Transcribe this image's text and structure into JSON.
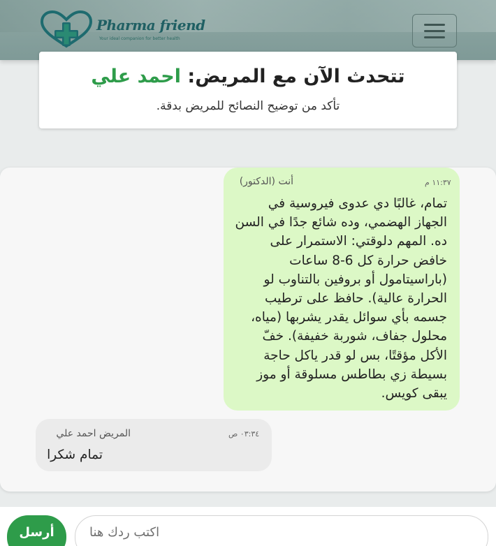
{
  "brand": {
    "name": "Pharma friend",
    "tagline": "Your ideal companion for better health",
    "logo_icon": "heart-cross-icon",
    "colors": {
      "brand_green": "#2e9c4a",
      "brand_teal": "#1f5f63"
    }
  },
  "nav": {
    "menu_icon": "hamburger-menu-icon"
  },
  "header": {
    "title_prefix": "تتحدث الآن مع المريض: ",
    "patient_name": "احمد علي",
    "subtitle": "تأكد من توضيح النصائح للمريض بدقة."
  },
  "messages": [
    {
      "sender": "أنت (الدكتور)",
      "time": "١١:٣٧ م",
      "text": "تمام، غالبًا دي عدوى فيروسية في الجهاز الهضمي، وده شائع جدًا في السن ده. المهم دلوقتي: الاستمرار على خافض حرارة كل 6-8 ساعات (باراسيتامول أو بروفين بالتناوب لو الحرارة عالية). حافظ على ترطيب جسمه بأي سوائل يقدر يشربها (مياه، محلول جفاف، شوربة خفيفة). خفّ الأكل مؤقتًا، بس لو قدر ياكل حاجة بسيطة زي بطاطس مسلوقة أو موز يبقى كويس.",
      "bubble_color": "#dcf8c6"
    },
    {
      "sender": "المريض احمد علي",
      "time": "٠٣:٣٤ ص",
      "text": "تمام شكرا",
      "bubble_color": "#ebebeb"
    }
  ],
  "composer": {
    "placeholder": "اكتب ردك هنا",
    "value": "",
    "send_label": "أرسل"
  }
}
